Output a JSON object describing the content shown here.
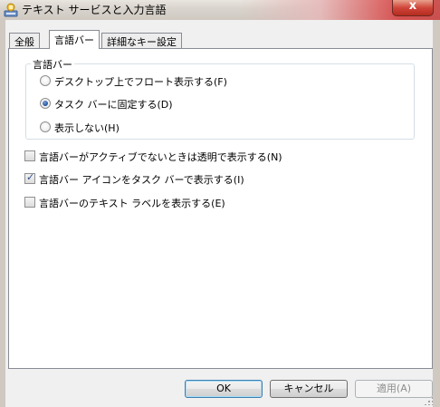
{
  "window": {
    "title": "テキスト サービスと入力言語",
    "close_glyph": "x",
    "icon": "language-bar-icon"
  },
  "tabs": [
    {
      "label": "全般",
      "active": false
    },
    {
      "label": "言語バー",
      "active": true
    },
    {
      "label": "詳細なキー設定",
      "active": false
    }
  ],
  "language_bar_group": {
    "label": "言語バー",
    "options": [
      {
        "label": "デスクトップ上でフロート表示する(F)",
        "selected": false
      },
      {
        "label": "タスク バーに固定する(D)",
        "selected": true
      },
      {
        "label": "表示しない(H)",
        "selected": false
      }
    ]
  },
  "checkboxes": [
    {
      "label": "言語バーがアクティブでないときは透明で表示する(N)",
      "checked": false
    },
    {
      "label": "言語バー アイコンをタスク バーで表示する(I)",
      "checked": true
    },
    {
      "label": "言語バーのテキスト ラベルを表示する(E)",
      "checked": false
    }
  ],
  "buttons": {
    "ok": "OK",
    "cancel": "キャンセル",
    "apply": "適用(A)"
  },
  "colors": {
    "accent": "#3c7fb1",
    "close_button": "#c73b2b",
    "panel": "#ffffff"
  }
}
